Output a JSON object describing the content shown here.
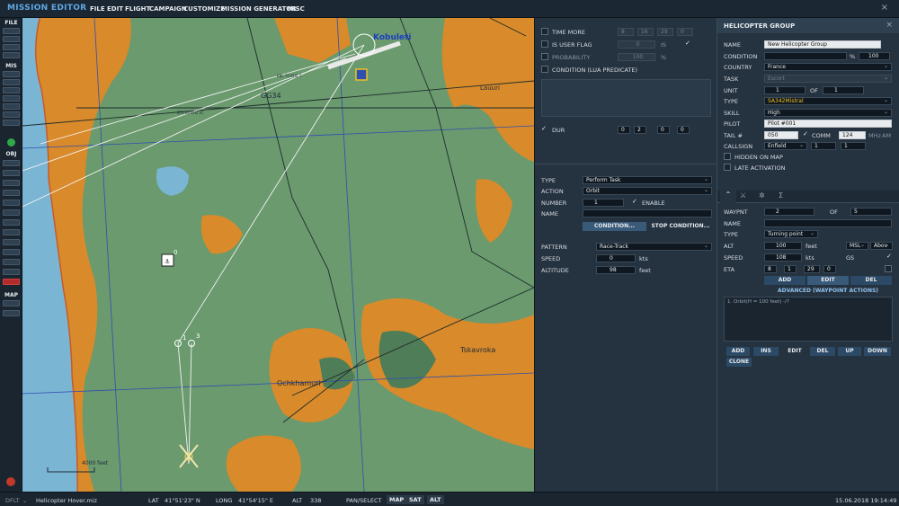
{
  "app": {
    "title": "MISSION EDITOR",
    "close": "×"
  },
  "menu": [
    "FILE",
    "EDIT",
    "FLIGHT",
    "CAMPAIGN",
    "CUSTOMIZE",
    "MISSION GENERATOR",
    "MISC"
  ],
  "toolbar": {
    "file": "FILE",
    "mis": "MIS",
    "obj": "OBJ",
    "map": "MAP"
  },
  "map": {
    "towns": [
      "Kobuleti",
      "GG34",
      "Lauuri",
      "Tskavroka",
      "Ochkhamuri"
    ],
    "beacons": [
      "KBL 70 KHZ T",
      "870 00 KHZ KT"
    ],
    "scale": "4000 feet",
    "wp_labels": [
      "0",
      "1",
      "3"
    ]
  },
  "trigger": {
    "time_more_label": "TIME MORE",
    "time_more": [
      "8",
      "16",
      "29",
      "0"
    ],
    "is_user_flag_label": "IS USER FLAG",
    "is_user_flag_value": "0",
    "is_label": "IS",
    "probability_label": "PROBABILITY",
    "probability_value": "100",
    "percent": "%",
    "condition_lua_label": "CONDITION (LUA PREDICATE)",
    "dur_label": "DUR",
    "dur": [
      "0",
      "2",
      "0",
      "0"
    ]
  },
  "task": {
    "type_label": "TYPE",
    "type": "Perform Task",
    "action_label": "ACTION",
    "action": "Orbit",
    "number_label": "NUMBER",
    "number": "1",
    "enable_label": "ENABLE",
    "name_label": "NAME",
    "condition_btn": "CONDITION...",
    "stop_condition_btn": "STOP CONDITION...",
    "pattern_label": "PATTERN",
    "pattern": "Race-Track",
    "speed_label": "SPEED",
    "speed": "0",
    "speed_unit": "kts",
    "altitude_label": "ALTITUDE",
    "altitude": "98",
    "altitude_unit": "feet"
  },
  "group": {
    "header": "HELICOPTER GROUP",
    "name_label": "NAME",
    "name": "New Helicopter Group",
    "condition_label": "CONDITION",
    "condition_pct": "100",
    "country_label": "COUNTRY",
    "country": "France",
    "task_label": "TASK",
    "task": "Escort",
    "unit_label": "UNIT",
    "unit": "1",
    "of_label": "OF",
    "unit_of": "1",
    "type_label": "TYPE",
    "type": "SA342Mistral",
    "skill_label": "SKILL",
    "skill": "High",
    "pilot_label": "PILOT",
    "pilot": "Pilot #001",
    "tail_label": "TAIL #",
    "tail": "050",
    "comm_label": "COMM",
    "comm": "124",
    "comm_unit": "MHz",
    "comm_mod": "AM",
    "callsign_label": "CALLSIGN",
    "callsign": "Enfield",
    "callsign_n1": "1",
    "callsign_n2": "1",
    "hidden_label": "HIDDEN ON MAP",
    "late_label": "LATE ACTIVATION"
  },
  "waypoint": {
    "wp_label": "WAYPNT",
    "wp": "2",
    "of_label": "OF",
    "wp_of": "5",
    "name_label": "NAME",
    "type_label": "TYPE",
    "type": "Turning point",
    "alt_label": "ALT",
    "alt": "100",
    "alt_unit": "feet",
    "alt_ref": "MSL",
    "alt_mode": "Abov",
    "speed_label": "SPEED",
    "speed": "108",
    "speed_unit": "kts",
    "gs_label": "GS",
    "eta_label": "ETA",
    "eta": [
      "8",
      "1",
      "29",
      "0"
    ],
    "add": "ADD",
    "edit": "EDIT",
    "del": "DEL",
    "advanced": "ADVANCED (WAYPOINT ACTIONS)",
    "action_item": "1. Orbit(H = 100 feet) -/?",
    "btns": [
      "ADD",
      "INS",
      "EDIT",
      "DEL",
      "UP",
      "DOWN"
    ],
    "clone": "CLONE"
  },
  "status": {
    "dflt": "DFLT",
    "file": "Helicopter Hover.miz",
    "lat_label": "LAT",
    "lat": "41°51'23\" N",
    "long_label": "LONG",
    "long": "41°54'15\" E",
    "alt_label": "ALT",
    "alt": "338",
    "pan": "PAN/SELECT",
    "map_btn": "MAP",
    "sat_btn": "SAT",
    "alt_btn": "ALT",
    "datetime": "15.06.2018 19:14:49"
  },
  "colors": {
    "accent": "#5fa8e6",
    "water": "#7bb5d4",
    "urban": "#d98a2a",
    "land": "#6a9a6e"
  }
}
